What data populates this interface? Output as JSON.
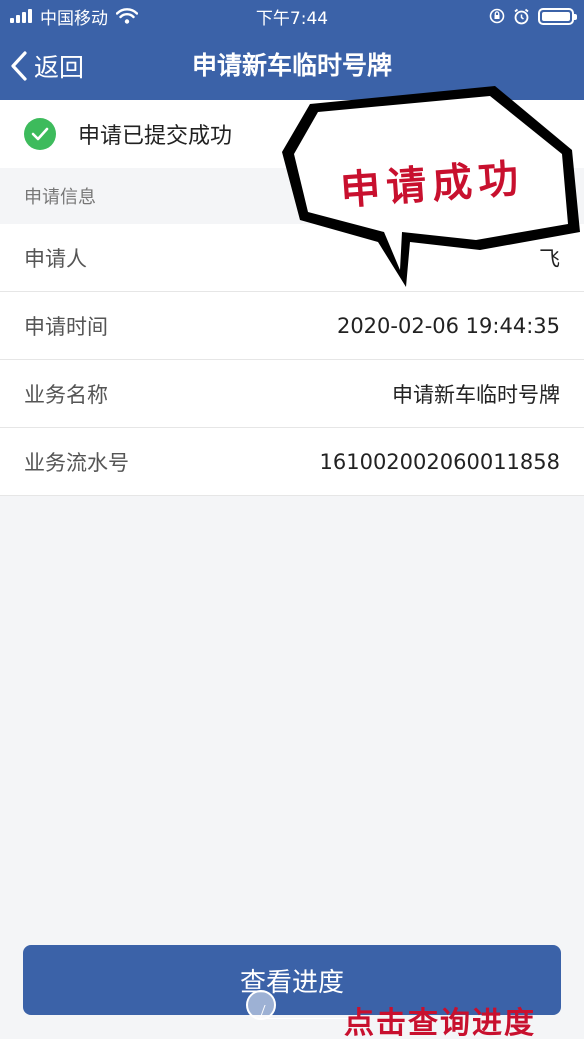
{
  "status_bar": {
    "carrier": "中国移动",
    "time": "下午7:44",
    "icons": [
      "signal-icon",
      "wifi-icon",
      "rotation-lock-icon",
      "alarm-icon",
      "battery-icon"
    ]
  },
  "nav": {
    "back_label": "返回",
    "title": "申请新车临时号牌"
  },
  "success": {
    "text": "申请已提交成功",
    "icon": "check-circle-icon",
    "color": "#3dbb5c"
  },
  "section": {
    "title": "申请信息"
  },
  "info": [
    {
      "label": "申请人",
      "value": "飞"
    },
    {
      "label": "申请时间",
      "value": "2020-02-06 19:44:35"
    },
    {
      "label": "业务名称",
      "value": "申请新车临时号牌"
    },
    {
      "label": "业务流水号",
      "value": "161002002060011858"
    }
  ],
  "overlay": {
    "bubble_text": "申请成功",
    "annotation_text": "点击查询进度",
    "color": "#c8102e"
  },
  "button": {
    "label": "查看进度"
  },
  "colors": {
    "brand": "#3b62a8",
    "background": "#f4f5f7"
  }
}
